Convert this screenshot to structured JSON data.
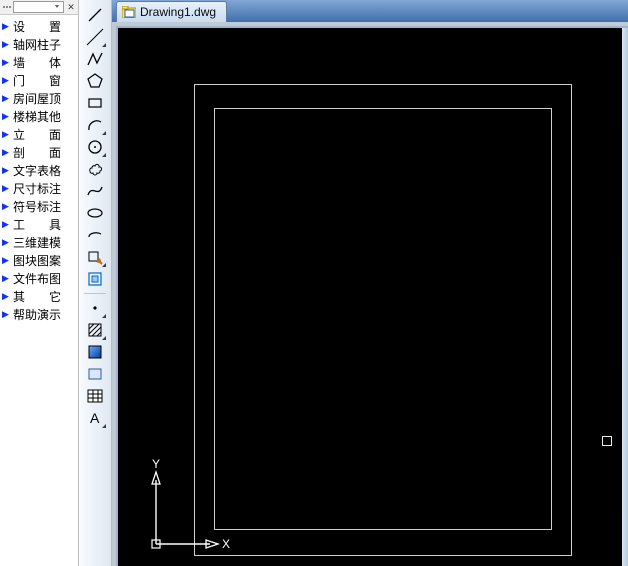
{
  "document": {
    "title": "Drawing1.dwg"
  },
  "side_header": {
    "close": "✕"
  },
  "menu": {
    "items": [
      {
        "label": "设　　置"
      },
      {
        "label": "轴网柱子"
      },
      {
        "label": "墙　　体"
      },
      {
        "label": "门　　窗"
      },
      {
        "label": "房间屋顶"
      },
      {
        "label": "楼梯其他"
      },
      {
        "label": "立　　面"
      },
      {
        "label": "剖　　面"
      },
      {
        "label": "文字表格"
      },
      {
        "label": "尺寸标注"
      },
      {
        "label": "符号标注"
      },
      {
        "label": "工　　具"
      },
      {
        "label": "三维建模"
      },
      {
        "label": "图块图案"
      },
      {
        "label": "文件布图"
      },
      {
        "label": "其　　它"
      },
      {
        "label": "帮助演示"
      }
    ]
  },
  "tools": [
    {
      "name": "line-tool"
    },
    {
      "name": "construction-line-tool"
    },
    {
      "name": "polyline-tool"
    },
    {
      "name": "polygon-tool"
    },
    {
      "name": "rectangle-tool"
    },
    {
      "name": "arc-tool"
    },
    {
      "name": "circle-tool"
    },
    {
      "name": "revision-cloud-tool"
    },
    {
      "name": "spline-tool"
    },
    {
      "name": "ellipse-tool"
    },
    {
      "name": "ellipse-arc-tool"
    },
    {
      "name": "insert-block-tool"
    },
    {
      "name": "make-block-tool"
    },
    {
      "name": "point-tool"
    },
    {
      "name": "hatch-tool"
    },
    {
      "name": "gradient-tool"
    },
    {
      "name": "region-tool"
    },
    {
      "name": "table-tool"
    },
    {
      "name": "mtext-tool"
    }
  ],
  "ucs": {
    "x_label": "X",
    "y_label": "Y"
  },
  "colors": {
    "accent": "#1030ff",
    "tabbar_top": "#82a7d6",
    "tabbar_bottom": "#3f6fab",
    "paper_border": "#cfcfcf"
  }
}
